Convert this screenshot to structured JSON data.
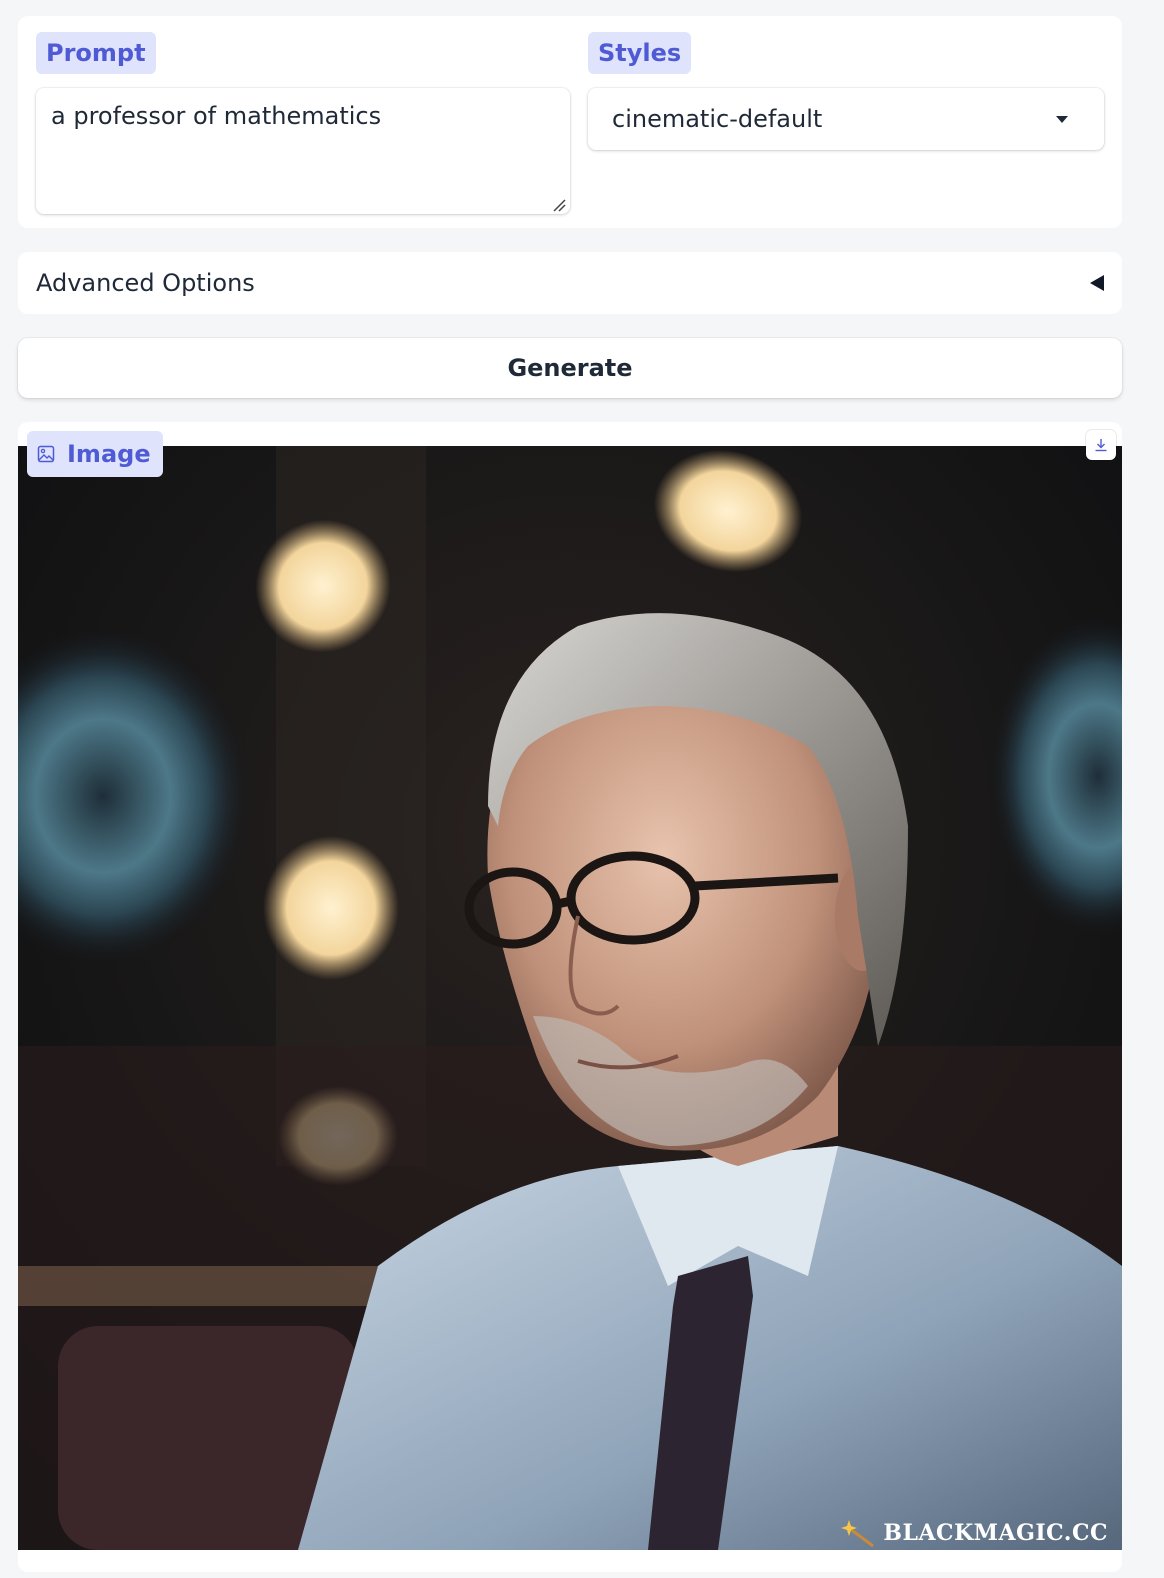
{
  "prompt": {
    "label": "Prompt",
    "value": "a professor of mathematics"
  },
  "styles": {
    "label": "Styles",
    "selected": "cinematic-default"
  },
  "advanced": {
    "label": "Advanced Options"
  },
  "generate": {
    "label": "Generate"
  },
  "output": {
    "label": "Image",
    "watermark": "BLACKMAGIC.CC",
    "download_icon": "download-icon",
    "image_icon": "image-icon"
  },
  "colors": {
    "accent": "#4f5bd5",
    "chip_bg": "#dfe3fb",
    "page_bg": "#f5f6f8"
  }
}
